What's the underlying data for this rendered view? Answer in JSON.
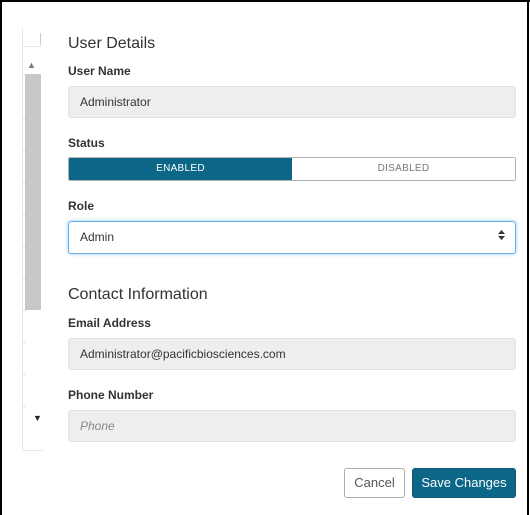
{
  "user_details": {
    "title": "User Details",
    "user_name_label": "User Name",
    "user_name_value": "Administrator",
    "status_label": "Status",
    "status_options": [
      "ENABLED",
      "DISABLED"
    ],
    "status_selected": "ENABLED",
    "role_label": "Role",
    "role_value": "Admin"
  },
  "contact_information": {
    "title": "Contact Information",
    "email_label": "Email Address",
    "email_value": "Administrator@pacificbiosciences.com",
    "phone_label": "Phone Number",
    "phone_placeholder": "Phone"
  },
  "actions": {
    "cancel_label": "Cancel",
    "save_label": "Save Changes"
  },
  "icons": {
    "scroll_up": "scroll-up-arrow-icon",
    "scroll_down": "scroll-down-arrow-icon",
    "select_arrow": "select-updown-arrows-icon"
  },
  "colors": {
    "accent": "#0b6688",
    "readonly_bg": "#eceeef",
    "focus_border": "#66afe9"
  }
}
